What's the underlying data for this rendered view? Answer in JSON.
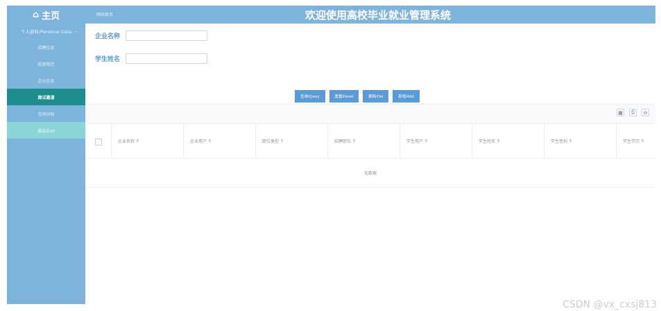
{
  "header": {
    "home_icon": "home-icon",
    "home_label": "主页",
    "breadcrumb": "网站首页",
    "system_title": "欢迎使用高校毕业就业管理系统"
  },
  "sidebar": {
    "group_label": "个人资料/Personal Data",
    "items": [
      {
        "label": "招聘信息"
      },
      {
        "label": "投递简历"
      },
      {
        "label": "企业信息"
      },
      {
        "label": "面试邀请"
      },
      {
        "label": "合同协助"
      },
      {
        "label": "退出/Exit"
      }
    ]
  },
  "search": {
    "company_label": "企业名称",
    "student_label": "学生姓名",
    "company_value": "",
    "student_value": ""
  },
  "buttons": {
    "query": "查询/Query",
    "reset": "重置/Reset",
    "delete": "删除/Del",
    "add": "新增/Add"
  },
  "toolbar": {
    "icons": [
      "columns-icon",
      "print-icon",
      "export-icon"
    ]
  },
  "table": {
    "columns": [
      "企业名称",
      "企业用户",
      "职位类型",
      "招聘职位",
      "学生用户",
      "学生姓名",
      "学生性别",
      "学生学历"
    ],
    "empty_text": "无数据"
  },
  "watermark": "CSDN @vx_cxsj813"
}
